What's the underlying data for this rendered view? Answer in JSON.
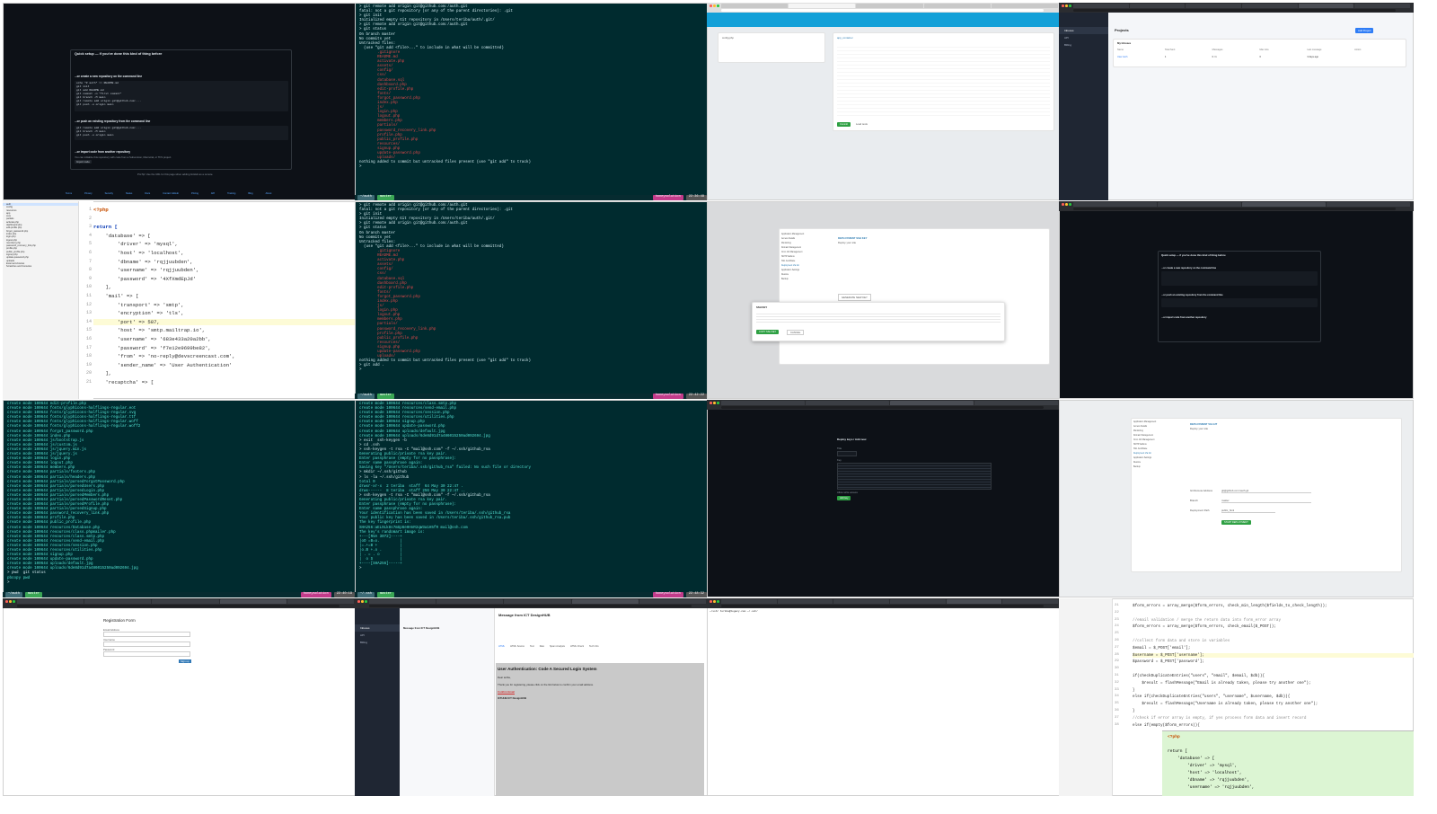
{
  "tile1": {
    "title": "Quick setup — if you've done this kind of thing before",
    "section_new_repo": "...or create a new repository on the command line",
    "new_repo_code": [
      "echo \"# auth\" >> README.md",
      "git init",
      "git add README.md",
      "git commit -m \"first commit\"",
      "git branch -M main",
      "git remote add origin git@github.com:...",
      "git push -u origin main"
    ],
    "section_push": "...or push an existing repository from the command line",
    "push_code": [
      "git remote add origin git@github.com:...",
      "git branch -M main",
      "git push -u origin main"
    ],
    "section_import": "...or import code from another repository",
    "import_text": "You can initialize this repository with code from a Subversion, Mercurial, or TFS project.",
    "import_button": "Import code",
    "protip": "ProTip! Use the URL for this page when adding GitHub as a remote.",
    "footer_items": [
      "Terms",
      "Privacy",
      "Security",
      "Status",
      "Docs",
      "Contact GitHub",
      "Pricing",
      "API",
      "Training",
      "Blog",
      "About"
    ]
  },
  "tile2": {
    "lines": [
      {
        "c": "white",
        "t": "> git remote add origin git@github.com:/auth.git"
      },
      {
        "c": "white",
        "t": "fatal: not a git repository (or any of the parent directories): .git"
      },
      {
        "c": "white",
        "t": "> git init"
      },
      {
        "c": "white",
        "t": "Initialized empty Git repository in /Users/teriba/auth/.git/"
      },
      {
        "c": "white",
        "t": "> git remote add origin git@github.com:/auth.git"
      },
      {
        "c": "white",
        "t": "> git status"
      },
      {
        "c": "white",
        "t": "On branch master"
      },
      {
        "c": "white",
        "t": ""
      },
      {
        "c": "white",
        "t": "No commits yet"
      },
      {
        "c": "white",
        "t": ""
      },
      {
        "c": "white",
        "t": "Untracked files:"
      },
      {
        "c": "white",
        "t": "  (use \"git add <file>...\" to include in what will be committed)"
      },
      {
        "c": "red",
        "t": "        .gitignore"
      },
      {
        "c": "red",
        "t": "        README.md"
      },
      {
        "c": "red",
        "t": "        activate.php"
      },
      {
        "c": "red",
        "t": "        assets/"
      },
      {
        "c": "red",
        "t": "        config/"
      },
      {
        "c": "red",
        "t": "        css/"
      },
      {
        "c": "red",
        "t": "        database.sql"
      },
      {
        "c": "red",
        "t": "        dashboard.php"
      },
      {
        "c": "red",
        "t": "        edit-profile.php"
      },
      {
        "c": "red",
        "t": "        fonts/"
      },
      {
        "c": "red",
        "t": "        forgot_password.php"
      },
      {
        "c": "red",
        "t": "        index.php"
      },
      {
        "c": "red",
        "t": "        js/"
      },
      {
        "c": "red",
        "t": "        login.php"
      },
      {
        "c": "red",
        "t": "        logout.php"
      },
      {
        "c": "red",
        "t": "        members.php"
      },
      {
        "c": "red",
        "t": "        partials/"
      },
      {
        "c": "red",
        "t": "        password_recovery_link.php"
      },
      {
        "c": "red",
        "t": "        profile.php"
      },
      {
        "c": "red",
        "t": "        public_profile.php"
      },
      {
        "c": "red",
        "t": "        resources/"
      },
      {
        "c": "red",
        "t": "        signup.php"
      },
      {
        "c": "red",
        "t": "        update-password.php"
      },
      {
        "c": "red",
        "t": "        uploads/"
      },
      {
        "c": "white",
        "t": ""
      },
      {
        "c": "white",
        "t": "nothing added to commit but untracked files present (use \"git add\" to track)"
      },
      {
        "c": "white",
        "t": "> "
      }
    ],
    "status_left": "~/auth",
    "status_branch": "master",
    "status_right": "honeysolution",
    "status_time": "22:36:48"
  },
  "tile5": {
    "lines": [
      {
        "n": "1",
        "t": "<?php",
        "k": "php"
      },
      {
        "n": "2",
        "t": ""
      },
      {
        "n": "3",
        "t": "return [",
        "k": "kw"
      },
      {
        "n": "4",
        "t": "    'database' => ["
      },
      {
        "n": "5",
        "t": "        'driver' => 'mysql',"
      },
      {
        "n": "6",
        "t": "        'host' => 'localhost',"
      },
      {
        "n": "7",
        "t": "        'dbname' => 'rqjjuubden',"
      },
      {
        "n": "8",
        "t": "        'username' => 'rqjjuubden',"
      },
      {
        "n": "9",
        "t": "        'password' => '4XfXmdEpJd'"
      },
      {
        "n": "10",
        "t": "    ],"
      },
      {
        "n": "11",
        "t": "    'mail' => ["
      },
      {
        "n": "12",
        "t": "        'transport' => 'smtp',"
      },
      {
        "n": "13",
        "t": "        'encryption' => 'tls',"
      },
      {
        "n": "14",
        "t": "        'port' => 587,"
      },
      {
        "n": "15",
        "t": "        'host' => 'smtp.mailtrap.io',"
      },
      {
        "n": "16",
        "t": "        'username' => '683e433a20a2bb',"
      },
      {
        "n": "17",
        "t": "        'password' => 'f7e12e9699be82',"
      },
      {
        "n": "18",
        "t": "        'from' => 'no-reply@devscreencast.com',"
      },
      {
        "n": "19",
        "t": "        'sender_name' => 'User Authentication'"
      },
      {
        "n": "20",
        "t": "    ],"
      },
      {
        "n": "21",
        "t": "    'recaptcha' => ["
      }
    ],
    "tree": [
      "auth",
      "config",
      "resources",
      "app",
      "core",
      "partials",
      "activate.php",
      "dashboard.php",
      "edit-profile.php",
      "forgot_password.php",
      "index.php",
      "login.php",
      "logout.php",
      "members.php",
      "password_recovery_link.php",
      "profile.php",
      "public_profile.php",
      "signup.php",
      "update-password.php",
      "uploads",
      "External Libraries",
      "Scratches and Consoles"
    ]
  },
  "tile3": {
    "section_title": "app_container",
    "buttons": [
      "Commit",
      "Load tests"
    ],
    "file_label": "config.php"
  },
  "tile4": {
    "title": "Projects",
    "table_heading": "My Inboxes",
    "columns": [
      "Name",
      "Total Sent",
      "Messages",
      "Max size",
      "Last message",
      "Action"
    ],
    "row": [
      "User Auth",
      "1",
      "0 / 1",
      "0",
      "3 days ago",
      ""
    ],
    "nav": [
      "Inboxes",
      "API",
      "Billing"
    ],
    "add_button": "Add Project"
  },
  "tile7": {
    "title": "DEPLOYMENT SSH KEY",
    "subtitle": "Deploy your site",
    "key_label": "SSH KEY",
    "copy_button": "COPY SSH KEY",
    "close_button": "CANCEL",
    "gen_button": "GENERATE NEW KEY",
    "side": [
      "Application Management",
      "Access Details",
      "Monitoring",
      "Domain Management",
      "Cron Job Management",
      "SMTP Addons",
      "SSL Certificate",
      "Deployment Via Git",
      "Application Settings",
      "Restore",
      "Backup"
    ]
  },
  "tile9": {
    "lines": [
      "create mode 100644 edit-profile.php",
      "create mode 100644 fonts/glyphicons-halflings-regular.eot",
      "create mode 100644 fonts/glyphicons-halflings-regular.svg",
      "create mode 100644 fonts/glyphicons-halflings-regular.ttf",
      "create mode 100644 fonts/glyphicons-halflings-regular.woff",
      "create mode 100644 fonts/glyphicons-halflings-regular.woff2",
      "create mode 100644 forgot_password.php",
      "create mode 100644 index.php",
      "create mode 100644 js/bootstrap.js",
      "create mode 100644 js/custom.js",
      "create mode 100644 js/jquery.min.js",
      "create mode 100644 js/jquery.js",
      "create mode 100644 login.php",
      "create mode 100644 logout.php",
      "create mode 100644 members.php",
      "create mode 100644 partials/footers.php",
      "create mode 100644 partials/headers.php",
      "create mode 100644 partials/parsedForgotPassword.php",
      "create mode 100644 partials/parsedUsers.php",
      "create mode 100644 partials/parsedLogin.php",
      "create mode 100644 partials/parsedMembers.php",
      "create mode 100644 partials/parsedPasswordReset.php",
      "create mode 100644 partials/parsedProfile.php",
      "create mode 100644 partials/parsedSignup.php",
      "create mode 100644 password_recovery_link.php",
      "create mode 100644 profile.php",
      "create mode 100644 public_profile.php",
      "create mode 100644 resources/Database.php",
      "create mode 100644 resources/class.phpmailer.php",
      "create mode 100644 resources/class.smtp.php",
      "create mode 100644 resources/send-email.php",
      "create mode 100644 resources/session.php",
      "create mode 100644 resources/utilities.php",
      "create mode 100644 signup.php",
      "create mode 100644 update-password.php",
      "create mode 100644 uploads/default.jpg",
      "create mode 100644 uploads/6de8d91d7a486015250ad092694.jpg",
      "> pwd  git status",
      "pbcopy pwd",
      "> "
    ],
    "status_left": "~/auth",
    "status_branch": "master",
    "status_right": "honeysolution",
    "status_time": "22:40:19"
  },
  "tile10": {
    "lines": [
      "create mode 100644 resources/class.smtp.php",
      "create mode 100644 resources/send-email.php",
      "create mode 100644 resources/session.php",
      "create mode 100644 resources/utilities.php",
      "create mode 100644 signup.php",
      "create mode 100644 update-password.php",
      "create mode 100644 uploads/default.jpg",
      "create mode 100644 uploads/6de8d91d7a486015250ad092694.jpg",
      "> exit  ssh-keygen -b",
      "> cd .ssh",
      "> ssh-keygen -t rsa -C \"mail@ssh.com\" -f ~/.ssh/github_rsa",
      "Generating public/private rsa key pair.",
      "Enter passphrase (empty for no passphrase):",
      "Enter same passphrase again:",
      "Saving key \"/Users/teriba/.ssh/github_rsa\" failed: No such file or directory",
      "> mkdir ~/.ssh/github",
      "> ls -la ~/.ssh/github",
      "total 0",
      "drwxr-xr-x  2 teriba  staff  64 May 30 22:47 .",
      "drwx------  8 teriba  staff 256 May 30 22:47 ..",
      "> ssh-keygen -t rsa -C \"mail@ssh.com\" -f ~/.ssh/github_rsa",
      "Generating public/private rsa key pair.",
      "Enter passphrase (empty for no passphrase):",
      "Enter same passphrase again:",
      "Your identification has been saved in /Users/teriba/.ssh/github_rsa",
      "Your public key has been saved in /Users/teriba/.ssh/github_rsa.pub",
      "The key fingerprint is:",
      "SHA256:aEL9Lk8s7mGp6eHHnR2qW3a1H5fR mail@ssh.com",
      "The key's randomart image is:",
      "+---[RSA 3072]----+",
      "|oO =B=o.         |",
      "|=.+=B +          |",
      "|o.B +.o .        |",
      "| . = . o         |",
      "|  o S            |",
      "+----[SHA256]-----+",
      "> "
    ],
    "status_left": "~/.ssh",
    "status_branch": "master",
    "status_right": "honeysolution",
    "status_time": "22:48:32"
  },
  "tile13": {
    "title": "Registration Form",
    "fields": [
      "Email Address",
      "Username",
      "Password"
    ],
    "placeholders": [
      "",
      "",
      "",
      ""
    ],
    "submit": "Sign up"
  },
  "tile14": {
    "nav": [
      "Inboxes",
      "API",
      "Billing"
    ],
    "message_title": "Message from ICT DesignHUB",
    "tabs": [
      "HTML",
      "HTML Source",
      "Text",
      "Raw",
      "Spam Analysis",
      "HTML Check",
      "Tech Info"
    ],
    "email_heading": "User Authentication: Code A Secured Login System",
    "email_greeting": "Dear teriba,",
    "email_body": "Thank you for registering, please click on the link below to confirm your email address.",
    "email_link": "Confirm Email",
    "email_sign": "ICTHUB ICT DesignHUB"
  },
  "tile15": {
    "prompt": "~/ssh/ teriba@legacy.com ~/.ssh/"
  },
  "tile16": {
    "lines": [
      {
        "n": "21",
        "t": "$form_errors = array_merge($form_errors, check_min_length($fields_to_check_length));"
      },
      {
        "n": "22",
        "t": ""
      },
      {
        "n": "23",
        "t": "//email validation / merge the return data into form_error array"
      },
      {
        "n": "24",
        "t": "$form_errors = array_merge($form_errors, check_email($_POST));"
      },
      {
        "n": "25",
        "t": ""
      },
      {
        "n": "26",
        "t": "//collect form data and store in variables"
      },
      {
        "n": "27",
        "t": "$email = $_POST['email'];"
      },
      {
        "n": "28",
        "t": "$username = $_POST['username'];"
      },
      {
        "n": "29",
        "t": "$password = $_POST['password'];"
      },
      {
        "n": "30",
        "t": ""
      },
      {
        "n": "31",
        "t": "if(checkDuplicateEntries(\"users\", \"email\", $email, $db)){"
      },
      {
        "n": "32",
        "t": "    $result = flashMessage(\"Email is already taken, please try another one\");"
      },
      {
        "n": "33",
        "t": "}"
      },
      {
        "n": "34",
        "t": "else if(checkDuplicateEntries(\"users\", \"username\", $username, $db)){"
      },
      {
        "n": "35",
        "t": "    $result = flashMessage(\"Username is already taken, please try another one\");"
      },
      {
        "n": "36",
        "t": "}"
      },
      {
        "n": "37",
        "t": "//check if error array is empty, if yes process form data and insert record"
      },
      {
        "n": "38",
        "t": "else if(empty($form_errors)){"
      }
    ],
    "overlay_lines": [
      "<?php",
      "",
      "return [",
      "    'database' => [",
      "        'driver' => 'mysql',",
      "        'host' => 'localhost',",
      "        'dbname' => 'rqjjuubden',",
      "        'username' => 'rqjjuubden',"
    ]
  },
  "tile8": {
    "section_title": "Quick setup — if you've done this kind of thing before",
    "new_repo": "...or create a new repository on the command line",
    "push": "...or push an existing repository from the command line",
    "import": "...or import code from another repository"
  },
  "tile11": {
    "title": "Deploy keys / Add new",
    "label_title": "Title",
    "label_key": "Key",
    "checkbox": "Allow write access",
    "button": "Add key"
  },
  "tile12": {
    "title": "DEPLOYMENT VIA GIT",
    "subtitle": "Deploy your site",
    "fields": [
      "Git Remote Address",
      "Branch",
      "Deployment Path"
    ],
    "values": [
      "git@github.com:/auth.git",
      "master",
      "public_html"
    ],
    "button": "START DEPLOYMENT"
  },
  "tile6": {
    "lines": [
      {
        "c": "white",
        "t": "> git remote add origin git@github.com:/auth.git"
      },
      {
        "c": "white",
        "t": "fatal: not a git repository (or any of the parent directories): .git"
      },
      {
        "c": "white",
        "t": "> git init"
      },
      {
        "c": "white",
        "t": "Initialized empty Git repository in /Users/teriba/auth/.git/"
      },
      {
        "c": "white",
        "t": "> git remote add origin git@github.com:/auth.git"
      },
      {
        "c": "white",
        "t": "> git status"
      },
      {
        "c": "white",
        "t": "On branch master"
      },
      {
        "c": "white",
        "t": ""
      },
      {
        "c": "white",
        "t": "No commits yet"
      },
      {
        "c": "white",
        "t": ""
      },
      {
        "c": "white",
        "t": "Untracked files:"
      },
      {
        "c": "white",
        "t": "  (use \"git add <file>...\" to include in what will be committed)"
      },
      {
        "c": "red",
        "t": "        .gitignore"
      },
      {
        "c": "red",
        "t": "        README.md"
      },
      {
        "c": "red",
        "t": "        activate.php"
      },
      {
        "c": "red",
        "t": "        assets/"
      },
      {
        "c": "red",
        "t": "        config/"
      },
      {
        "c": "red",
        "t": "        css/"
      },
      {
        "c": "red",
        "t": "        database.sql"
      },
      {
        "c": "red",
        "t": "        dashboard.php"
      },
      {
        "c": "red",
        "t": "        edit-profile.php"
      },
      {
        "c": "red",
        "t": "        fonts/"
      },
      {
        "c": "red",
        "t": "        forgot_password.php"
      },
      {
        "c": "red",
        "t": "        index.php"
      },
      {
        "c": "red",
        "t": "        js/"
      },
      {
        "c": "red",
        "t": "        login.php"
      },
      {
        "c": "red",
        "t": "        logout.php"
      },
      {
        "c": "red",
        "t": "        members.php"
      },
      {
        "c": "red",
        "t": "        partials/"
      },
      {
        "c": "red",
        "t": "        password_recovery_link.php"
      },
      {
        "c": "red",
        "t": "        profile.php"
      },
      {
        "c": "red",
        "t": "        public_profile.php"
      },
      {
        "c": "red",
        "t": "        resources/"
      },
      {
        "c": "red",
        "t": "        signup.php"
      },
      {
        "c": "red",
        "t": "        update-password.php"
      },
      {
        "c": "red",
        "t": "        uploads/"
      },
      {
        "c": "white",
        "t": ""
      },
      {
        "c": "white",
        "t": "nothing added to commit but untracked files present (use \"git add\" to track)"
      },
      {
        "c": "white",
        "t": "> git add ."
      },
      {
        "c": "white",
        "t": "> "
      }
    ],
    "status_left": "~/auth",
    "status_branch": "master",
    "status_right": "honeysolution",
    "status_time": "22:42:22"
  }
}
